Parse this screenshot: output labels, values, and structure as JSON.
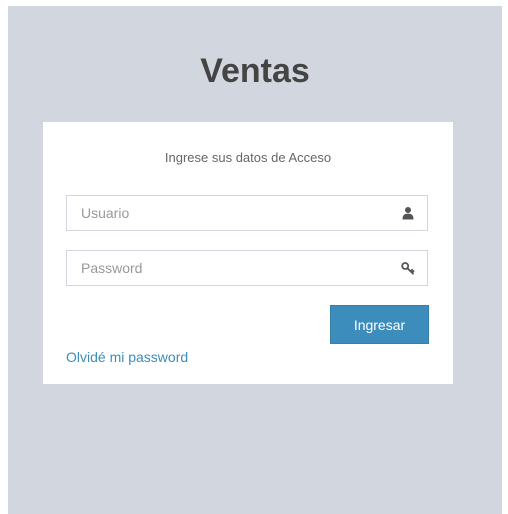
{
  "app": {
    "title": "Ventas"
  },
  "login": {
    "message": "Ingrese sus datos de Acceso",
    "username": {
      "placeholder": "Usuario",
      "value": "",
      "icon": "user-icon"
    },
    "password": {
      "placeholder": "Password",
      "value": "",
      "icon": "key-icon"
    },
    "submit_label": "Ingresar",
    "forgot_label": "Olvidé mi password"
  },
  "colors": {
    "background": "#d2d6de",
    "primary": "#3c8dbc",
    "title": "#444444"
  }
}
